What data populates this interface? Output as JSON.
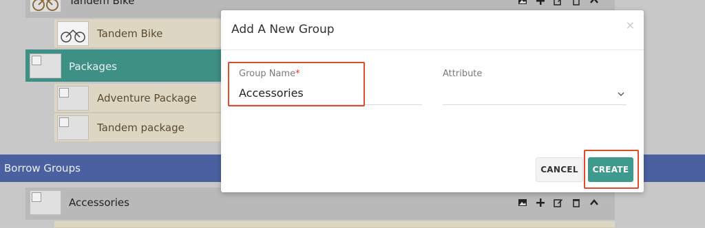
{
  "background": {
    "rows": {
      "tandem_bike_parent": "Tandem Bike",
      "tandem_bike_child": "Tandem Bike",
      "packages": "Packages",
      "adventure_package": "Adventure Package",
      "tandem_package": "Tandem package",
      "borrow_groups": "Borrow Groups",
      "accessories": "Accessories"
    }
  },
  "modal": {
    "title": "Add A New Group",
    "close_glyph": "×",
    "group_name": {
      "label": "Group Name",
      "required_mark": "*",
      "value": "Accessories"
    },
    "attribute": {
      "label": "Attribute",
      "value": ""
    },
    "buttons": {
      "cancel": "CANCEL",
      "create": "CREATE"
    }
  },
  "colors": {
    "accent_teal": "#3e9a8c",
    "header_blue": "#4a60a0",
    "highlight_red": "#e04a2f"
  }
}
